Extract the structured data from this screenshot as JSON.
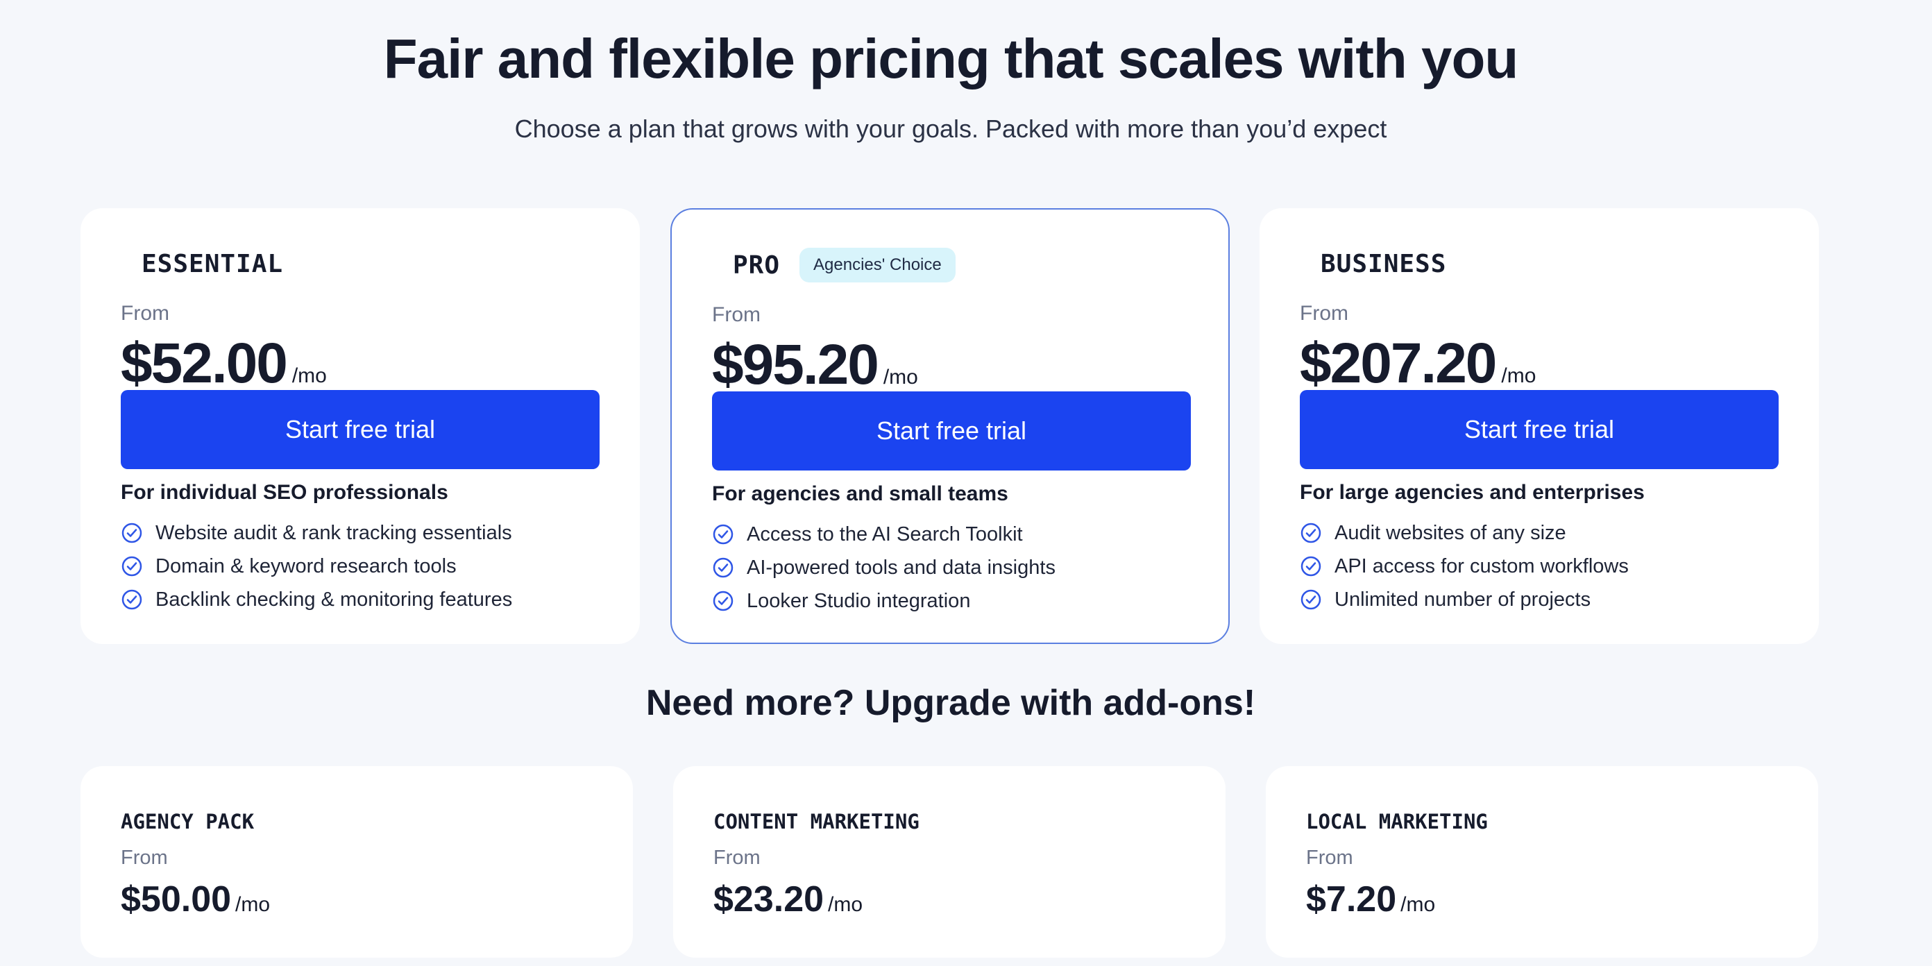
{
  "header": {
    "title": "Fair and flexible pricing that scales with you",
    "subtitle": "Choose a plan that grows with your goals. Packed with more than you’d expect"
  },
  "colors": {
    "accent": "#1b44f0",
    "badge_bg": "#d8f4fb",
    "page_bg": "#f5f7fb",
    "check": "#2f56e6"
  },
  "plans": [
    {
      "name": "ESSENTIAL",
      "badge": "",
      "from_label": "From",
      "price": "$52.00",
      "per": "/mo",
      "cta": "Start free trial",
      "audience": "For individual SEO professionals",
      "features": [
        "Website audit & rank tracking essentials",
        "Domain & keyword research tools",
        "Backlink checking & monitoring features"
      ]
    },
    {
      "name": "PRO",
      "badge": "Agencies' Choice",
      "from_label": "From",
      "price": "$95.20",
      "per": "/mo",
      "cta": "Start free trial",
      "audience": "For agencies and small teams",
      "features": [
        "Access to the AI Search Toolkit",
        "AI-powered tools and data insights",
        "Looker Studio integration"
      ]
    },
    {
      "name": "BUSINESS",
      "badge": "",
      "from_label": "From",
      "price": "$207.20",
      "per": "/mo",
      "cta": "Start free trial",
      "audience": "For large agencies and enterprises",
      "features": [
        "Audit websites of any size",
        "API access for custom workflows",
        "Unlimited number of projects"
      ]
    }
  ],
  "addons": {
    "title": "Need more? Upgrade with add-ons!",
    "items": [
      {
        "name": "AGENCY PACK",
        "from_label": "From",
        "price": "$50.00",
        "per": "/mo"
      },
      {
        "name": "CONTENT MARKETING",
        "from_label": "From",
        "price": "$23.20",
        "per": "/mo"
      },
      {
        "name": "LOCAL MARKETING",
        "from_label": "From",
        "price": "$7.20",
        "per": "/mo"
      }
    ]
  },
  "icons": {
    "feature_check": "check-circle-icon"
  }
}
